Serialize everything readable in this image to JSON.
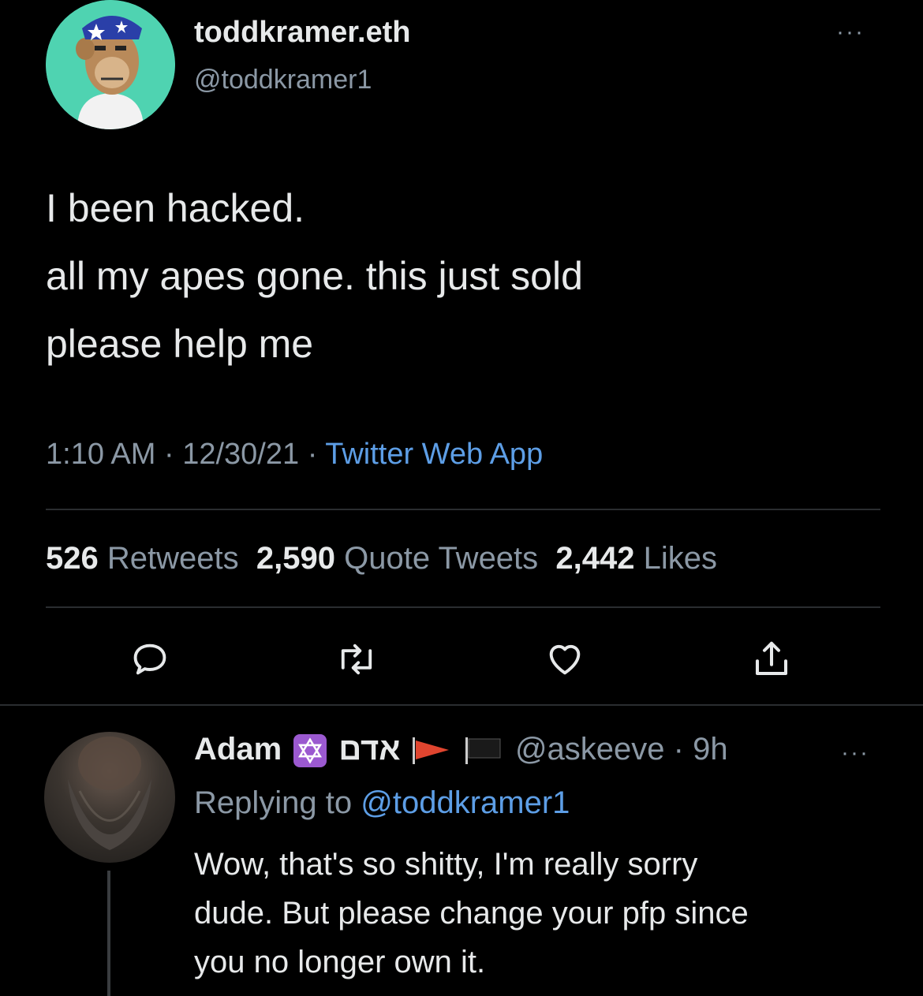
{
  "tweet": {
    "display_name": "toddkramer.eth",
    "handle": "@toddkramer1",
    "text_lines": [
      "I been hacked.",
      "all my apes gone. this just sold",
      "please help me"
    ],
    "time": "1:10 AM",
    "date": "12/30/21",
    "sep": "·",
    "source": "Twitter Web App",
    "stats": {
      "retweets_count": "526",
      "retweets_label": "Retweets",
      "quotes_count": "2,590",
      "quotes_label": "Quote Tweets",
      "likes_count": "2,442",
      "likes_label": "Likes"
    },
    "more": "···"
  },
  "reply": {
    "display_name": "Adam",
    "hebrew_name": "אדם",
    "handle_time": "@askeeve · 9h",
    "replying_prefix": "Replying to",
    "replying_handle": "@toddkramer1",
    "text_lines": [
      "Wow, that's so shitty, I'm really sorry",
      "dude. But please change your pfp since",
      "you no longer own it."
    ],
    "more": "···"
  },
  "colors": {
    "background": "#000000",
    "text": "#e7e9ea",
    "muted": "#8b98a5",
    "link": "#5d9ee6",
    "avatar_bg": "#4fd3b1",
    "badge": "#9b59d0"
  },
  "icons": [
    "reply-icon",
    "retweet-icon",
    "like-icon",
    "share-icon",
    "star-of-david-icon",
    "red-flag-icon",
    "black-flag-icon"
  ]
}
